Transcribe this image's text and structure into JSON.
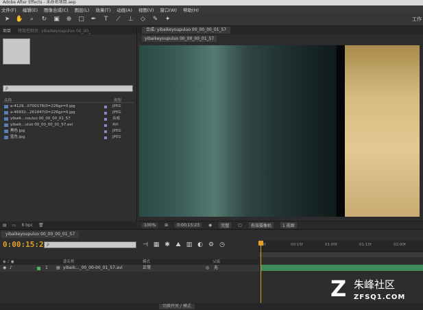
{
  "app": {
    "title": "Adobe After Effects - 未命名项目.aep"
  },
  "menu": {
    "items": [
      "文件(F)",
      "编辑(E)",
      "图像合成(C)",
      "图层(L)",
      "效果(T)",
      "动画(A)",
      "视图(V)",
      "窗口(W)",
      "帮助(H)"
    ]
  },
  "toolbar": {
    "workspace": "工作"
  },
  "project": {
    "tabs": [
      "项目",
      "特效控制台: yibaikeyoupuluo 00_00_"
    ],
    "search_placeholder": "ρ",
    "col_name": "名称",
    "col_type": "类型",
    "items": [
      {
        "name": "a-4129...0700176(0=226gz=0.jpg",
        "type": "JPEG"
      },
      {
        "name": "a-46932...261847(0=226gz=0.jpg",
        "type": "JPEG"
      },
      {
        "name": "yibaik...couluo 00_00_00_01_57",
        "type": "合成"
      },
      {
        "name": "yibaik...uluo 00_00_00_01_57.avi",
        "type": "AVI"
      },
      {
        "name": "黑色 jpg",
        "type": "JPEG"
      },
      {
        "name": "蓝色 jpg",
        "type": "JPEG"
      }
    ],
    "footer_bpc": "8 bpc"
  },
  "viewer": {
    "tab": "合成: yibaikeyoupuluo 00_00_00_01_57",
    "subtab": "yibaikeyoupuluo 00_00_00_01_57",
    "zoom": "100%",
    "timecode": "0:00:15:23",
    "resolution": "完整",
    "camera": "有效摄像机",
    "views": "1 视图"
  },
  "timeline": {
    "tab": "yibaikeyoupuluo 00_00_00_01_57",
    "timecode": "0:00:15:23",
    "search_placeholder": "ρ",
    "col_source": "源名称",
    "col_mode": "模式",
    "col_parent": "父级",
    "ruler_marks": [
      "0f",
      "00:15f",
      "01:00f",
      "01:15f",
      "02:00f"
    ],
    "layer": {
      "index": "1",
      "name": "yibaik..._00_00-00_01_57.avi",
      "mode": "正常",
      "parent": "无"
    },
    "footer_toggle": "切换开关 / 模式"
  },
  "watermark": {
    "title": "朱峰社区",
    "url": "ZFSQ1.COM"
  }
}
